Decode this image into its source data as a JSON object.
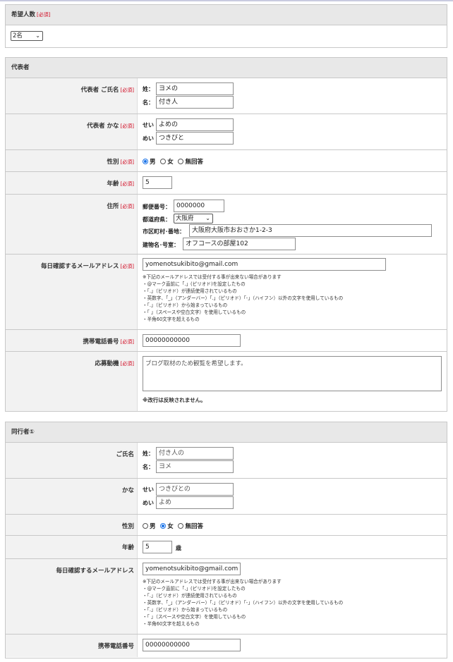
{
  "required_tag": "[必須]",
  "guests": {
    "title": "希望人数",
    "value": "2名"
  },
  "rep": {
    "section_title": "代表者",
    "name": {
      "label": "代表者 ご氏名",
      "sei_label": "姓：",
      "mei_label": "名：",
      "sei_value": "ヨメの",
      "mei_value": "付き人"
    },
    "kana": {
      "label": "代表者 かな",
      "sei_label": "せい",
      "mei_label": "めい",
      "sei_value": "よめの",
      "mei_value": "つきびと"
    },
    "gender": {
      "label": "性別",
      "options": [
        "男",
        "女",
        "無回答"
      ],
      "selected": "男"
    },
    "age": {
      "label": "年齢",
      "value": "5"
    },
    "address": {
      "label": "住所",
      "zip_label": "郵便番号：",
      "zip_value": "0000000",
      "pref_label": "都道府県：",
      "pref_value": "大阪府",
      "city_label": "市区町村･番地：",
      "city_value": "大阪府大阪市おおさか1-2-3",
      "bldg_label": "建物名･号室：",
      "bldg_value": "オフコースの部屋102"
    },
    "email": {
      "label": "毎日確認するメールアドレス",
      "value": "yomenotsukibito@gmail.com",
      "notes": [
        "※下記のメールアドレスでは受付する事が出来ない場合があります",
        "・@マーク直前に「.」(ピリオド)を設定したもの",
        "・「.」（ピリオド）が連続使用されているもの",
        "・英数字、「_」（アンダーバー）「.」（ピリオド）「-」（ハイフン）以外の文字を使用しているもの",
        "・「.」（ピリオド）から始まっているもの",
        "・「 」（スペースや空白文字）を使用しているもの",
        "・半角60文字を超えるもの"
      ]
    },
    "phone": {
      "label": "携帯電話番号",
      "value": "00000000000"
    },
    "motive": {
      "label": "応募動機",
      "placeholder": "ブログ取材のため観覧を希望します。",
      "note": "※改行は反映されません。"
    }
  },
  "comp": {
    "section_title": "同行者①",
    "name": {
      "label": "ご氏名",
      "sei_label": "姓：",
      "mei_label": "名：",
      "sei_value": "付き人の",
      "mei_value": "ヨメ"
    },
    "kana": {
      "label": "かな",
      "sei_label": "せい",
      "mei_label": "めい",
      "sei_value": "つきびとの",
      "mei_value": "よめ"
    },
    "gender": {
      "label": "性別",
      "options": [
        "男",
        "女",
        "無回答"
      ],
      "selected": "女"
    },
    "age": {
      "label": "年齢",
      "value": "5",
      "unit": "歳"
    },
    "email": {
      "label": "毎日確認するメールアドレス",
      "value": "yomenotsukibito@gmail.com",
      "notes": [
        "※下記のメールアドレスでは受付する事が出来ない場合があります",
        "・@マーク直前に「.」(ピリオド)を設定したもの",
        "・「.」（ピリオド）が連続使用されているもの",
        "・英数字、「_」（アンダーバー）「.」（ピリオド）「-」（ハイフン）以外の文字を使用しているもの",
        "・「.」（ピリオド）から始まっているもの",
        "・「 」（スペースや空白文字）を使用しているもの",
        "・半角60文字を超えるもの"
      ]
    },
    "phone": {
      "label": "携帯電話番号",
      "value": "00000000000"
    }
  },
  "colors": {
    "required": "#d0021b",
    "header_bg": "#e8e8e8",
    "label_bg": "#f2f2f2",
    "radio_accent": "#1a73e8"
  }
}
